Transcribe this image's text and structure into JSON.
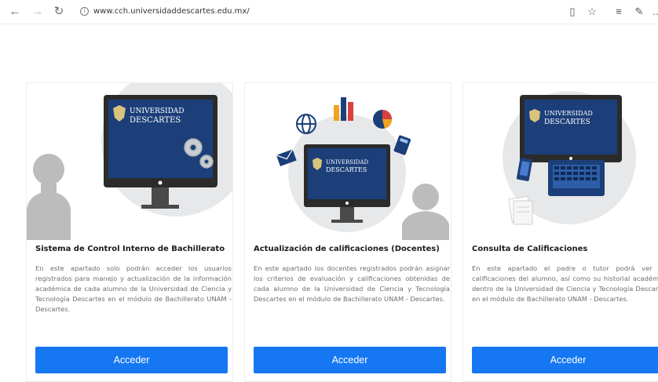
{
  "browser": {
    "url": "www.cch.universidaddescartes.edu.mx/",
    "back_icon": "back-arrow-icon",
    "forward_icon": "forward-arrow-icon",
    "refresh_icon": "refresh-icon"
  },
  "logo_text": {
    "line1": "UNIVERSIDAD",
    "line2": "DESCARTES"
  },
  "cards": [
    {
      "title": "Sistema de Control Interno de Bachillerato",
      "description": "En este apartado solo podrán acceder los usuarios registrados para manejo y actualización de la información académica de cada alumno de la Universidad de Ciencia y Tecnología Descartes en el módulo de Bachillerato UNAM - Descartes.",
      "button": "Acceder"
    },
    {
      "title": "Actualización de calificaciones (Docentes)",
      "description": "En este apartado los docentes registrados podrán asignar los criterios de evaluación y calificaciones obtenidas de cada alumno de la Universidad de Ciencia y Tecnología Descartes en el módulo de Bachillerato UNAM - Descartes.",
      "button": "Acceder"
    },
    {
      "title": "Consulta de Calificaciones",
      "description": "En este apartado el padre o tutor podrá ver las calificaciones del alumno, así como su historial académico dentro de la Universidad de Ciencia y Tecnología Descartes en el módulo de Bachillerato UNAM - Descartes.",
      "button": "Acceder"
    }
  ],
  "colors": {
    "accent": "#1677f2",
    "screen": "#1c3f7a",
    "monitor": "#2b2b2b",
    "circle": "#e6e8ea"
  }
}
